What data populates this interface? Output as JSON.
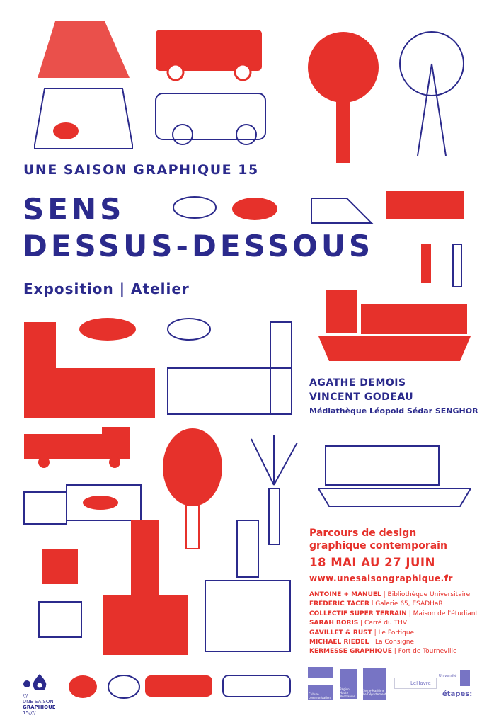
{
  "header": {
    "series": "UNE SAISON GRAPHIQUE 15",
    "title_line1": "SENS",
    "title_line2": "DESSUS-DESSOUS",
    "subtitle": "Exposition | Atelier"
  },
  "artists": {
    "name1": "AGATHE DEMOIS",
    "name2": "VINCENT GODEAU",
    "venue": "Médiathèque Léopold Sédar SENGHOR"
  },
  "program": {
    "line1": "Parcours de design",
    "line2": "graphique contemporain",
    "dates": "18 MAI AU 27 JUIN",
    "url": "www.unesaisongraphique.fr",
    "exhibitions": [
      {
        "artist": "ANTOINE + MANUEL",
        "sep": " | ",
        "venue": "Bibliothèque Universitaire"
      },
      {
        "artist": "FRÉDÉRIC TACER",
        "sep": " l ",
        "venue": "Galerie 65, ESADHaR"
      },
      {
        "artist": "COLLECTIF SUPER TERRAIN",
        "sep": " | ",
        "venue": "Maison de l'étudiant"
      },
      {
        "artist": "SARAH BORIS",
        "sep": " | ",
        "venue": "Carré du THV"
      },
      {
        "artist": "GAVILLET & RUST",
        "sep": " | ",
        "venue": "Le Portique"
      },
      {
        "artist": "MICHAEL RIEDEL",
        "sep": " | ",
        "venue": "La Consigne"
      },
      {
        "artist": "KERMESSE GRAPHIQUE",
        "sep": " | ",
        "venue": "Fort de Tourneville"
      }
    ]
  },
  "footer": {
    "logo_l1": "///",
    "logo_l2": "UNE SAISON",
    "logo_l3": "GRAPHIQUE",
    "logo_l4": "15////",
    "partners": [
      "Culture communication",
      "Région Haute Normandie",
      "Seine-Maritime Le Département",
      "LeHavre",
      "Université",
      "étapes:"
    ]
  },
  "colors": {
    "blue": "#2b2a8c",
    "red": "#e6312b"
  }
}
